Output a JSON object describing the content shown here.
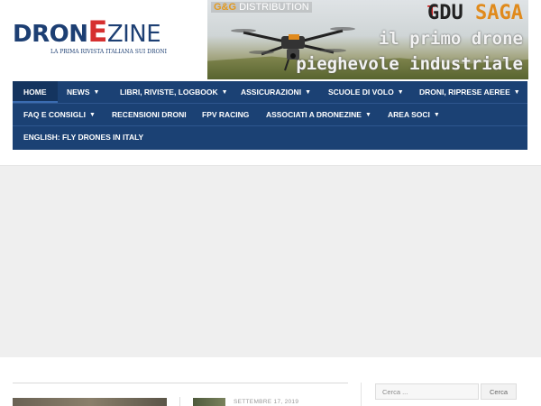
{
  "logo": {
    "prefix": "DRON",
    "highlight": "E",
    "suffix": "ZINE",
    "tagline": "LA PRIMA RIVISTA ITALIANA SUI DRONI"
  },
  "banner": {
    "distributor_brand": "G&G",
    "distributor_word": "DISTRIBUTION",
    "product_brand": "GDU",
    "product_name": "SAGA",
    "headline_line1": "il primo drone",
    "headline_line2": "pieghevole industriale"
  },
  "nav": {
    "row1": [
      {
        "label": "HOME",
        "active": true,
        "dropdown": false
      },
      {
        "label": "NEWS",
        "active": false,
        "dropdown": true
      },
      {
        "label": "LIBRI, RIVISTE, LOGBOOK",
        "active": false,
        "dropdown": true
      },
      {
        "label": "ASSICURAZIONI",
        "active": false,
        "dropdown": true
      },
      {
        "label": "SCUOLE DI VOLO",
        "active": false,
        "dropdown": true
      },
      {
        "label": "DRONI, RIPRESE AEREE",
        "active": false,
        "dropdown": true
      }
    ],
    "row2": [
      {
        "label": "FAQ E CONSIGLI",
        "active": false,
        "dropdown": true
      },
      {
        "label": "RECENSIONI DRONI",
        "active": false,
        "dropdown": false
      },
      {
        "label": "FPV RACING",
        "active": false,
        "dropdown": false
      },
      {
        "label": "ASSOCIATI A DRONEZINE",
        "active": false,
        "dropdown": true
      },
      {
        "label": "AREA SOCI",
        "active": false,
        "dropdown": true
      }
    ],
    "row3": [
      {
        "label": "ENGLISH: FLY DRONES IN ITALY",
        "active": false,
        "dropdown": false
      }
    ]
  },
  "post": {
    "date": "SETTEMBRE 17, 2019"
  },
  "search": {
    "placeholder": "Cerca ...",
    "button_label": "Cerca"
  },
  "colors": {
    "nav_background": "#1b4174",
    "logo_blue": "#1d3f73",
    "logo_red": "#d63030",
    "banner_orange": "#e08a1c"
  }
}
